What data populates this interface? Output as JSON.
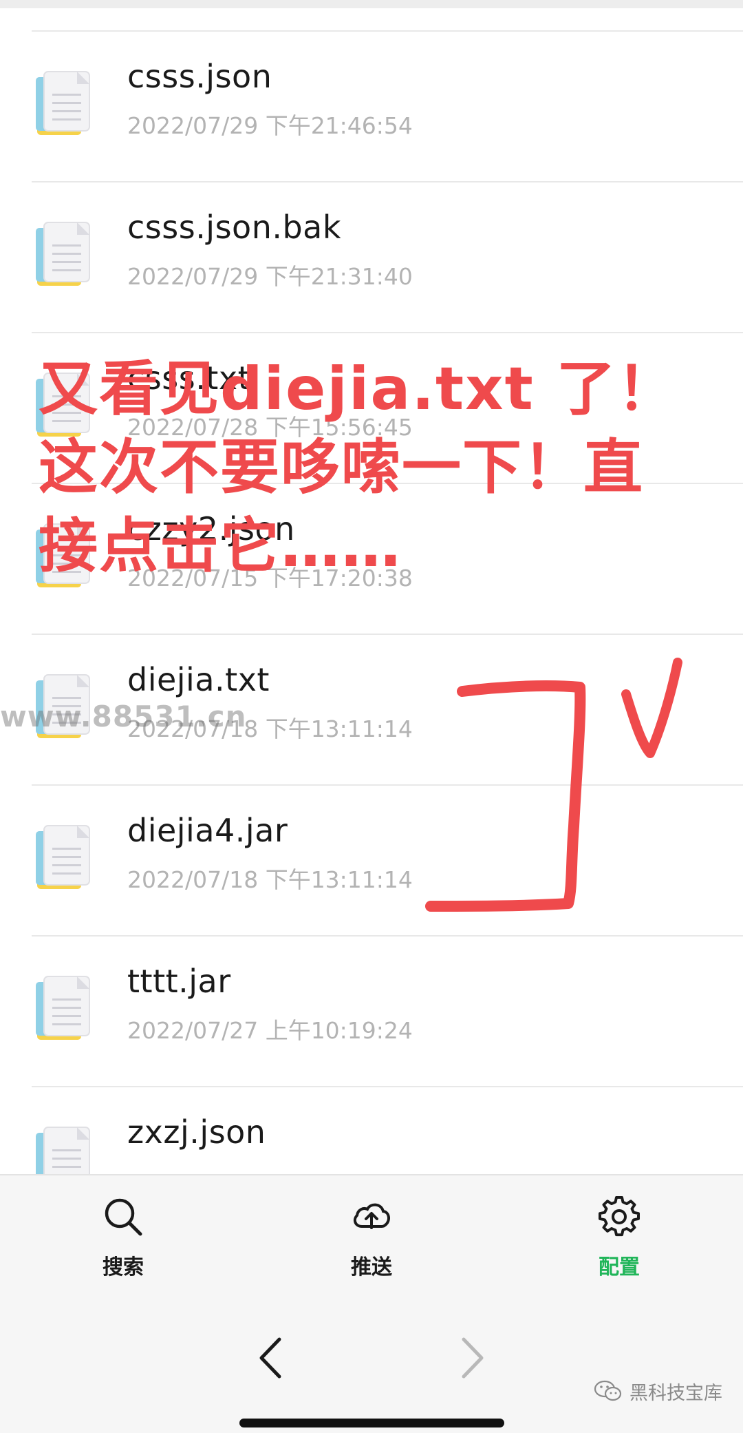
{
  "files": [
    {
      "name": "csss.json",
      "date": "2022/07/29 下午21:46:54"
    },
    {
      "name": "csss.json.bak",
      "date": "2022/07/29 下午21:31:40"
    },
    {
      "name": "csss.txt",
      "date": "2022/07/28 下午15:56:45"
    },
    {
      "name": "czzy2.json",
      "date": "2022/07/15 下午17:20:38"
    },
    {
      "name": "diejia.txt",
      "date": "2022/07/18 下午13:11:14"
    },
    {
      "name": "diejia4.jar",
      "date": "2022/07/18 下午13:11:14"
    },
    {
      "name": "tttt.jar",
      "date": "2022/07/27 上午10:19:24"
    },
    {
      "name": "zxzj.json",
      "date": ""
    }
  ],
  "annotation": {
    "text": "又看见diejia.txt 了！\n这次不要哆嗦一下！直\n接点击它……",
    "color": "#ef4a4c"
  },
  "watermark": "www.88531.cn",
  "tabbar": {
    "tabs": [
      {
        "label": "搜索",
        "icon": "search-icon",
        "active": false
      },
      {
        "label": "推送",
        "icon": "cloud-upload-icon",
        "active": false
      },
      {
        "label": "配置",
        "icon": "gear-icon",
        "active": true
      }
    ],
    "active_color": "#20b559"
  },
  "navbar": {
    "back_icon": "chevron-left-icon",
    "forward_icon": "chevron-right-icon"
  },
  "wechat_account": "黑科技宝库"
}
